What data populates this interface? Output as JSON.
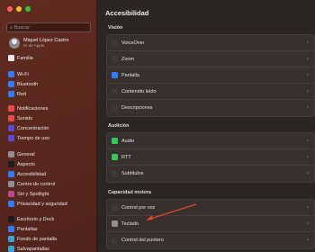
{
  "window": {
    "title": "Accesibilidad"
  },
  "search": {
    "placeholder": "Buscar"
  },
  "account": {
    "name": "Miquel López Castro",
    "subtitle": "ID de Apple"
  },
  "sidebar": {
    "items": [
      {
        "label": "Familia",
        "icon": "family-icon",
        "color": "#e8e8e8"
      },
      {
        "label": "Wi-Fi",
        "icon": "wifi-icon",
        "color": "#2f7cf6"
      },
      {
        "label": "Bluetooth",
        "icon": "bluetooth-icon",
        "color": "#2f7cf6"
      },
      {
        "label": "Red",
        "icon": "globe-icon",
        "color": "#2f7cf6"
      },
      {
        "label": "Notificaciones",
        "icon": "bell-icon",
        "color": "#e84a4a"
      },
      {
        "label": "Sonido",
        "icon": "speaker-icon",
        "color": "#e84a4a"
      },
      {
        "label": "Concentración",
        "icon": "moon-icon",
        "color": "#5b4ad6"
      },
      {
        "label": "Tiempo de uso",
        "icon": "hourglass-icon",
        "color": "#5b4ad6"
      },
      {
        "label": "General",
        "icon": "gear-icon",
        "color": "#8e8e93"
      },
      {
        "label": "Aspecto",
        "icon": "appearance-icon",
        "color": "#1c1c1e"
      },
      {
        "label": "Accesibilidad",
        "icon": "accessibility-icon",
        "color": "#2f7cf6"
      },
      {
        "label": "Centro de control",
        "icon": "control-center-icon",
        "color": "#8e8e93"
      },
      {
        "label": "Siri y Spotlight",
        "icon": "siri-icon",
        "color": "#c0448f"
      },
      {
        "label": "Privacidad y seguridad",
        "icon": "hand-icon",
        "color": "#2f7cf6"
      },
      {
        "label": "Escritorio y Dock",
        "icon": "dock-icon",
        "color": "#1c1c1e"
      },
      {
        "label": "Pantallas",
        "icon": "display-icon",
        "color": "#2f7cf6"
      },
      {
        "label": "Fondo de pantalla",
        "icon": "wallpaper-icon",
        "color": "#36a3d9"
      },
      {
        "label": "Salvapantallas",
        "icon": "screensaver-icon",
        "color": "#36a3d9"
      }
    ]
  },
  "main": {
    "sections": [
      {
        "title": "Visión",
        "rows": [
          {
            "label": "VoiceOver",
            "icon": "voiceover-icon",
            "color": "#3a3a3c"
          },
          {
            "label": "Zoom",
            "icon": "zoom-icon",
            "color": "#3a3a3c"
          },
          {
            "label": "Pantalla",
            "icon": "display-icon",
            "color": "#2f7cf6"
          },
          {
            "label": "Contenido leído",
            "icon": "speech-bubble-icon",
            "color": "#3a3a3c"
          },
          {
            "label": "Descripciones",
            "icon": "captions-icon",
            "color": "#3a3a3c"
          }
        ]
      },
      {
        "title": "Audición",
        "rows": [
          {
            "label": "Audio",
            "icon": "audio-icon",
            "color": "#34c759"
          },
          {
            "label": "RTT",
            "icon": "rtt-icon",
            "color": "#34c759"
          },
          {
            "label": "Subtítulos",
            "icon": "subtitles-icon",
            "color": "#3a3a3c"
          }
        ]
      },
      {
        "title": "Capacidad motora",
        "rows": [
          {
            "label": "Control por voz",
            "icon": "voice-control-icon",
            "color": "#3a3a3c"
          },
          {
            "label": "Teclado",
            "icon": "keyboard-icon",
            "color": "#8e8e93"
          },
          {
            "label": "Control del puntero",
            "icon": "pointer-icon",
            "color": "#3a3a3c"
          }
        ]
      }
    ],
    "chevron": "›"
  },
  "colors": {
    "accent": "#2f7cf6",
    "annotation_arrow": "#d9482a"
  }
}
